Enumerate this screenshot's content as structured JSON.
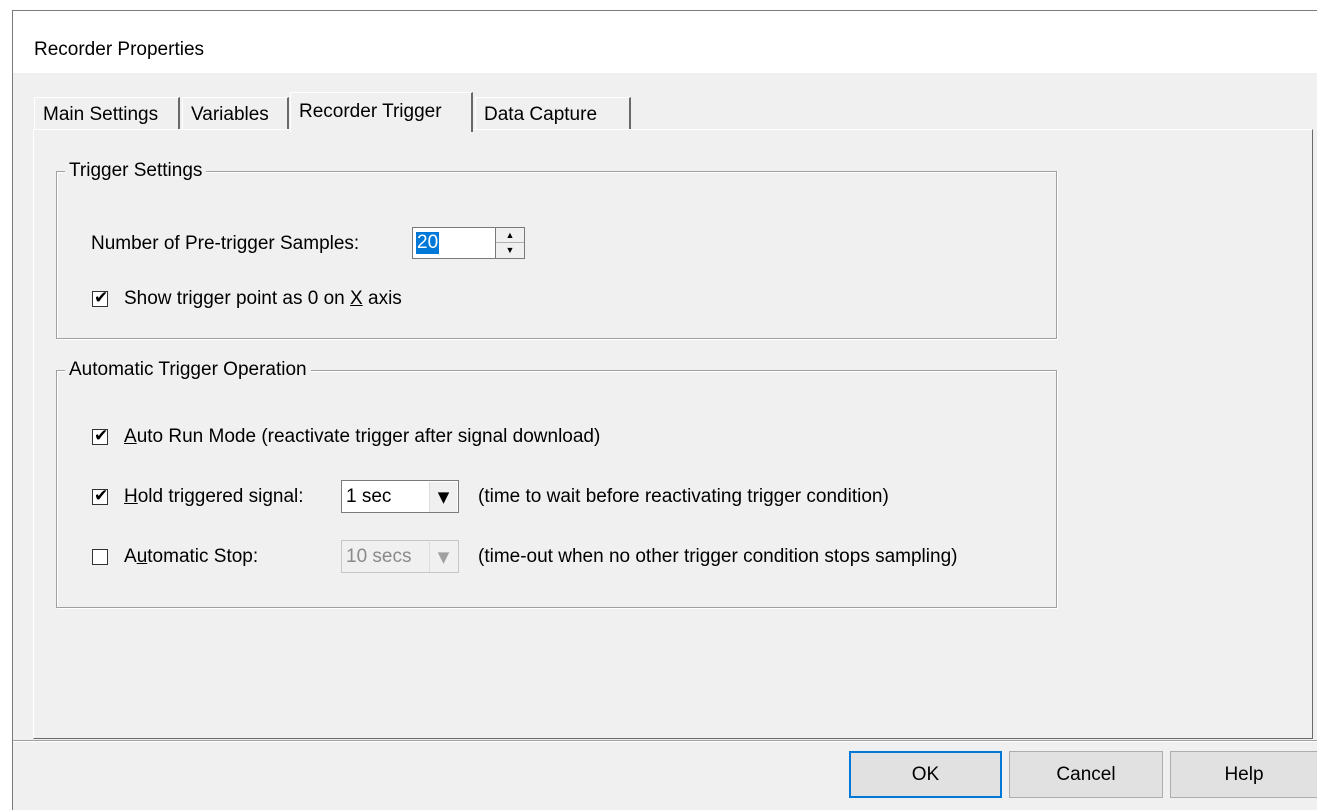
{
  "window": {
    "title": "Recorder Properties"
  },
  "tabs": [
    {
      "label": "Main Settings",
      "active": false
    },
    {
      "label": "Variables",
      "active": false
    },
    {
      "label": "Recorder Trigger",
      "active": true
    },
    {
      "label": "Data Capture",
      "active": false
    }
  ],
  "trigger_settings": {
    "group_title": "Trigger Settings",
    "pretrigger_label": "Number of Pre-trigger Samples:",
    "pretrigger_value": "20",
    "show_trigger_checked": true,
    "show_trigger_label_pre": "Show trigger point as 0 on ",
    "show_trigger_label_accel": "X",
    "show_trigger_label_post": " axis"
  },
  "auto_trigger": {
    "group_title": "Automatic Trigger Operation",
    "auto_run": {
      "checked": true,
      "accel": "A",
      "label_rest": "uto Run Mode (reactivate trigger after signal download)"
    },
    "hold": {
      "checked": true,
      "accel": "H",
      "label_rest": "old triggered signal:",
      "combo_value": "1 sec",
      "hint": "(time to wait before reactivating trigger condition)"
    },
    "auto_stop": {
      "checked": false,
      "label_pre": "A",
      "accel": "u",
      "label_rest": "tomatic Stop:",
      "combo_value": "10 secs",
      "combo_disabled": true,
      "hint": "(time-out when no other trigger condition stops sampling)"
    }
  },
  "buttons": {
    "ok": "OK",
    "cancel": "Cancel",
    "help": "Help"
  },
  "colors": {
    "dialog_bg": "#f0f0f0",
    "selection": "#0078d7",
    "default_button_border": "#0078d7"
  }
}
